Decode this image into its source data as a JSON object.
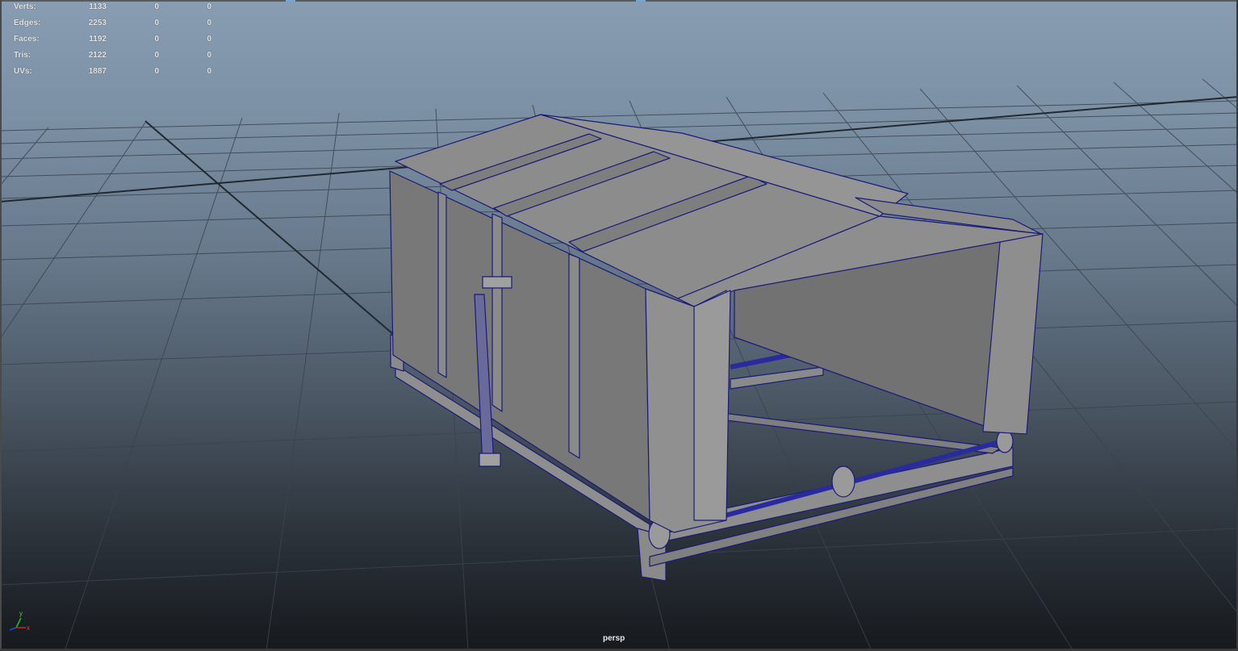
{
  "hud": {
    "rows": [
      {
        "label": "Verts:",
        "v1": "1133",
        "v2": "0",
        "v3": "0"
      },
      {
        "label": "Edges:",
        "v1": "2253",
        "v2": "0",
        "v3": "0"
      },
      {
        "label": "Faces:",
        "v1": "1192",
        "v2": "0",
        "v3": "0"
      },
      {
        "label": "Tris:",
        "v1": "2122",
        "v2": "0",
        "v3": "0"
      },
      {
        "label": "UVs:",
        "v1": "1887",
        "v2": "0",
        "v3": "0"
      }
    ]
  },
  "camera": {
    "name": "persp"
  },
  "axis": {
    "y": "y",
    "x": "x"
  },
  "colors": {
    "wireframe": "#1e1e8c",
    "surface": "#8a8a8a",
    "grid": "#3d4650",
    "axis_x": "#d02020",
    "axis_y": "#20c020",
    "axis_z": "#2050d0"
  }
}
